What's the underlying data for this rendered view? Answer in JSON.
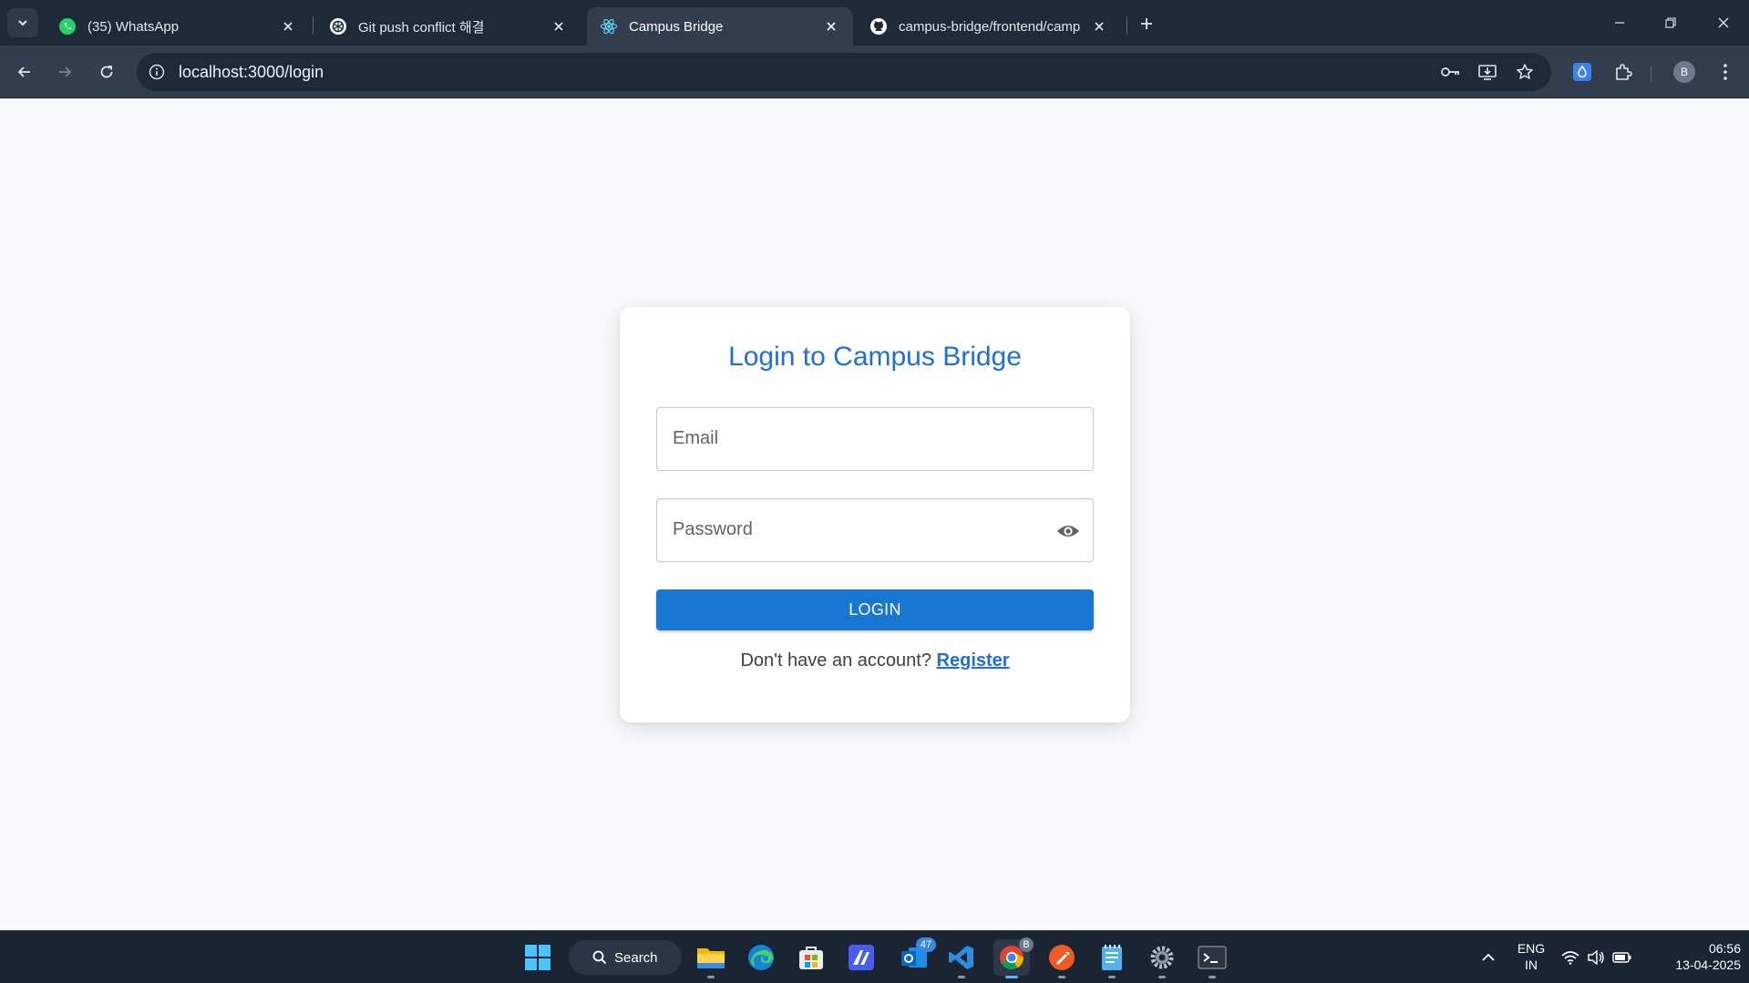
{
  "browser": {
    "tabs": [
      {
        "title": "(35) WhatsApp",
        "icon": "whatsapp-icon",
        "active": false
      },
      {
        "title": "Git push conflict 해결",
        "icon": "chatgpt-icon",
        "active": false
      },
      {
        "title": "Campus Bridge",
        "icon": "react-icon",
        "active": true
      },
      {
        "title": "campus-bridge/frontend/camp",
        "icon": "github-icon",
        "active": false
      }
    ],
    "url": "localhost:3000/login",
    "profile_initial": "B"
  },
  "login_card": {
    "title": "Login to Campus Bridge",
    "email_placeholder": "Email",
    "password_placeholder": "Password",
    "login_label": "LOGIN",
    "register_prompt": "Don't have an account?",
    "register_link": "Register"
  },
  "taskbar": {
    "search_label": "Search",
    "outlook_badge": "47",
    "chrome_badge": "B",
    "language_primary": "ENG",
    "language_secondary": "IN",
    "time": "06:56",
    "date": "13-04-2025"
  },
  "colors": {
    "accent": "#1976d2",
    "title_blue": "#1f6fd6",
    "tabbar_bg": "#1f2a38",
    "toolbar_bg": "#323d4d"
  }
}
